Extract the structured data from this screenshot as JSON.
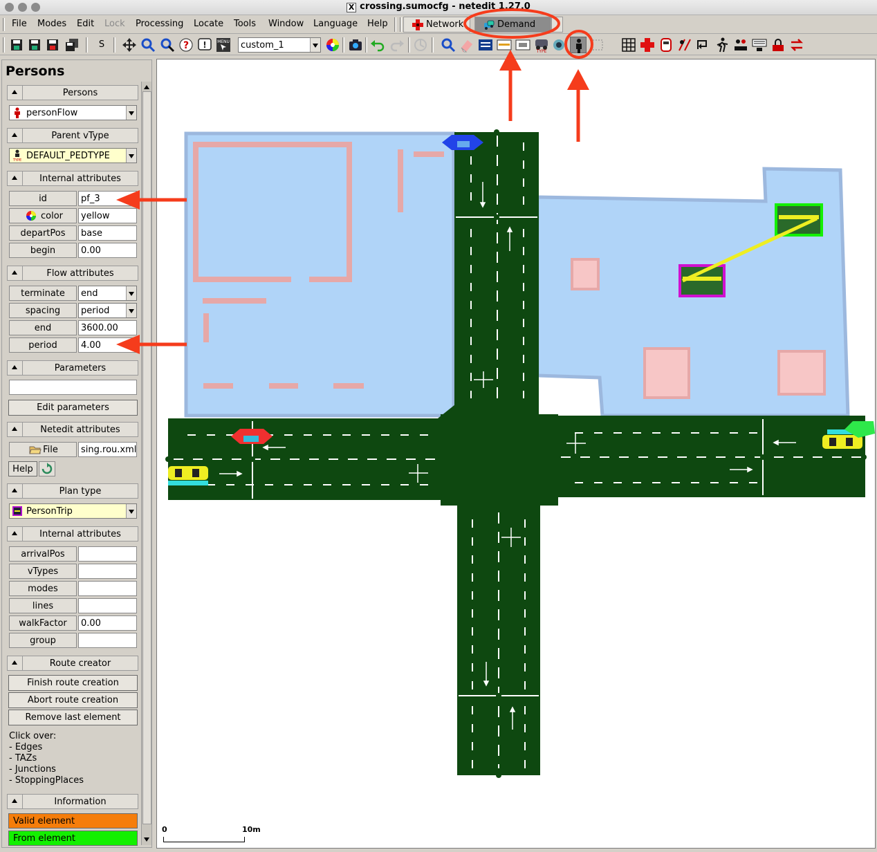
{
  "window": {
    "title": "crossing.sumocfg - netedit 1.27.0"
  },
  "menubar": {
    "items": [
      {
        "label": "File"
      },
      {
        "label": "Modes"
      },
      {
        "label": "Edit"
      },
      {
        "label": "Lock"
      },
      {
        "label": "Processing"
      },
      {
        "label": "Locate"
      },
      {
        "label": "Tools"
      },
      {
        "label": "Window"
      },
      {
        "label": "Language"
      },
      {
        "label": "Help"
      }
    ],
    "supermodes": {
      "network": "Network",
      "demand": "Demand"
    }
  },
  "toolbar": {
    "s_label": "S",
    "scheme_select": "custom_1"
  },
  "panel": {
    "title": "Persons",
    "persons_group": {
      "header": "Persons",
      "selected": "personFlow"
    },
    "vtype_group": {
      "header": "Parent vType",
      "selected": "DEFAULT_PEDTYPE"
    },
    "internal_group": {
      "header": "Internal attributes",
      "rows": [
        {
          "label": "id",
          "value": "pf_3"
        },
        {
          "label": "color",
          "value": "yellow"
        },
        {
          "label": "departPos",
          "value": "base"
        },
        {
          "label": "begin",
          "value": "0.00"
        }
      ]
    },
    "flow_group": {
      "header": "Flow attributes",
      "rows": [
        {
          "label": "terminate",
          "value": "end"
        },
        {
          "label": "spacing",
          "value": "period"
        },
        {
          "label": "end",
          "value": "3600.00"
        },
        {
          "label": "period",
          "value": "4.00"
        }
      ]
    },
    "parameters_group": {
      "header": "Parameters",
      "value": "",
      "edit_button": "Edit parameters"
    },
    "netedit_group": {
      "header": "Netedit attributes",
      "file_label": "File",
      "file_value": "sing.rou.xml",
      "help_button": "Help"
    },
    "plan_group": {
      "header": "Plan type",
      "selected": "PersonTrip"
    },
    "plan_internal_group": {
      "header": "Internal attributes",
      "rows": [
        {
          "label": "arrivalPos",
          "value": ""
        },
        {
          "label": "vTypes",
          "value": ""
        },
        {
          "label": "modes",
          "value": ""
        },
        {
          "label": "lines",
          "value": ""
        },
        {
          "label": "walkFactor",
          "value": "0.00"
        },
        {
          "label": "group",
          "value": ""
        }
      ]
    },
    "route_group": {
      "header": "Route creator",
      "buttons": [
        "Finish route creation",
        "Abort route creation",
        "Remove last element"
      ],
      "hint_lines": [
        "Click over:",
        "- Edges",
        "- TAZs",
        "- Junctions",
        "- StoppingPlaces"
      ]
    },
    "info_group": {
      "header": "Information",
      "items": [
        {
          "label": "Valid element",
          "color": "#f57d0a"
        },
        {
          "label": "From element",
          "color": "#13f000"
        }
      ]
    }
  },
  "canvas": {
    "scale": {
      "start": "0",
      "end": "10m"
    },
    "colors": {
      "road": "#0e4810",
      "polygon": "#b0d4f8",
      "polygon_border": "#9cb8de",
      "building": "#f7c6c6",
      "annotation": "#f53c1c"
    }
  }
}
